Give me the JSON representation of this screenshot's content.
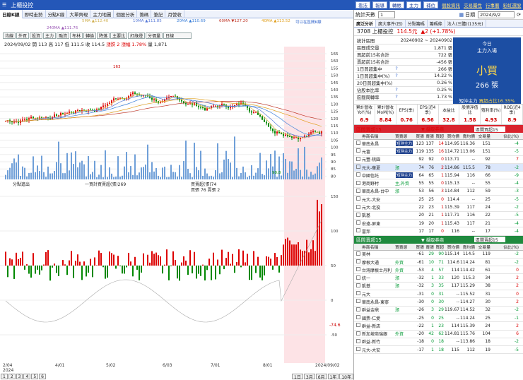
{
  "window": {
    "title": "上櫃投控",
    "buttons": [
      "看法",
      "報導",
      "轉帳",
      "主力",
      "補位"
    ],
    "links": [
      "個股資訊",
      "交易屬性",
      "行事曆",
      "彩虹選股"
    ]
  },
  "tabs": [
    "日線K線",
    "即時走勢",
    "分點K線",
    "大單齊現",
    "主力地圖",
    "個股分析",
    "籌碼",
    "筆記",
    "月營收"
  ],
  "legend": {
    "ma5": "5MA ▲112.40",
    "ma10": "10MA ▲111.85",
    "ma20": "20MA ▲110.69",
    "ma60": "60MA ▼127.20",
    "ma40": "40MA ▲113.52",
    "ma240": "240MA ▲111.76",
    "checkbox": "可以在區間K線"
  },
  "toolbar": [
    "均線",
    "外買",
    "投資",
    "主力",
    "融資",
    "布林",
    "轉換",
    "降落",
    "主要比",
    "紅綠燈",
    "分價量",
    "日線"
  ],
  "ohlc": {
    "date": "2024/09/02",
    "open": "開 113",
    "high": "高 117",
    "low": "低 111.5",
    "close": "收 114.5",
    "change": "漲跌 2",
    "pct": "漲幅 1.78%",
    "vol": "量 1,871"
  },
  "price_labels": {
    "high": "163",
    "low": "90.8"
  },
  "y_ticks": [
    "165",
    "160",
    "155",
    "150",
    "145",
    "140",
    "135",
    "130",
    "125",
    "120",
    "115",
    "110",
    "105",
    "100",
    "95",
    "90",
    "85",
    "80"
  ],
  "sub": {
    "label": "分點進出",
    "legend1": "一買計買賣超(張)269",
    "legend2": "買賣超(張)74",
    "legend3": "買張 76 賣張 2",
    "ticks": [
      "150",
      "100",
      "50",
      "0",
      "-50",
      "-100"
    ],
    "val": "-74.6"
  },
  "x_dates": [
    "2/04\n2024",
    "4/01",
    "5/02",
    "6/03",
    "7/01",
    "8/01",
    "2024/09/02"
  ],
  "bottom": {
    "pages": [
      "1",
      "2",
      "3",
      "4",
      "5",
      "6"
    ],
    "ranges": [
      "1日",
      "3月",
      "6月",
      "1年",
      "10年"
    ]
  },
  "right": {
    "count_label": "統計天數",
    "count_val": "1",
    "date_label": "日期",
    "date_val": "2024/9/2",
    "rtabs": [
      "廣泛分析",
      "廣大事件(日)",
      "分點籌碼",
      "籌碼條",
      "法人(三體)(135元)"
    ],
    "stock": "3708 上櫃投控",
    "price": "114.5元",
    "chg": "▲2 (+1.78%)",
    "stats": [
      {
        "k": "統計區間",
        "v": "20240902 ~ 20240902",
        "q": ""
      },
      {
        "k": "區間成交量",
        "v": "1,871 張",
        "q": ""
      },
      {
        "k": "買超前15名合計",
        "v": "722 張",
        "q": ""
      },
      {
        "k": "賣超前15名合計",
        "v": "-456 張",
        "q": ""
      },
      {
        "k": "1日買超集中",
        "v": "266 張",
        "q": "?"
      },
      {
        "k": "1日買超集中(%)",
        "v": "14.22 %",
        "q": "?"
      },
      {
        "k": "20日買超集中(%)",
        "v": "0.26 %",
        "q": ""
      },
      {
        "k": "佔股本比率",
        "v": "0.25 %",
        "q": "?"
      },
      {
        "k": "區間周轉率",
        "v": "1.73 %",
        "q": "?"
      }
    ],
    "big": {
      "l1": "今日",
      "l2": "主力入場",
      "l3": "小買",
      "l4": "266 張",
      "l5a": "短沖主力",
      "l5b": "買超占比16.35%"
    },
    "metrics": [
      {
        "h": "累計營收YoY(%)",
        "v": "6.9"
      },
      {
        "h": "累計營收MoM(%)",
        "v": "8.84"
      },
      {
        "h": "EPS(季)",
        "v": "0.76"
      },
      {
        "h": "EPS(近4季)",
        "v": "6.56"
      },
      {
        "h": "本益比",
        "v": "32.8"
      },
      {
        "h": "股價淨值比",
        "v": "1.58"
      },
      {
        "h": "殖利率(%)",
        "v": "4.93"
      },
      {
        "h": "ROE(近4季)",
        "v": "8.9"
      }
    ],
    "buy_hdr": "區間買超15",
    "buy_mid": "▼ 擷取券商",
    "dd": "區間買超15",
    "cols": [
      "",
      "券商名稱",
      "買賣原",
      "買張",
      "賣張",
      "買超",
      "買均價",
      "賣均價",
      "交易量",
      "佔比(%)"
    ],
    "buys": [
      [
        "華南永昌",
        "短沖主力",
        "123",
        "137",
        "14",
        "114.95",
        "116.36",
        "151",
        "-4"
      ],
      [
        "元富",
        "短沖主力",
        "119",
        "135",
        "16",
        "114.72",
        "113.06",
        "151",
        "-5"
      ],
      [
        "元豐-桃園",
        "",
        "92",
        "92",
        "0",
        "113.71",
        "--",
        "92",
        "7"
      ],
      [
        "元大-華夏",
        "漲",
        "74",
        "76",
        "2",
        "114.86",
        "115.5",
        "78",
        "-2"
      ],
      [
        "中國信託",
        "短沖主力",
        "64",
        "65",
        "1",
        "115.94",
        "116",
        "66",
        "-9"
      ],
      [
        "港商野村",
        "主,外資",
        "55",
        "55",
        "0",
        "115.13",
        "--",
        "55",
        "-4"
      ],
      [
        "華南永昌-台中",
        "漲",
        "53",
        "56",
        "3",
        "114.84",
        "112",
        "59",
        "-3"
      ],
      [
        "元大-大安",
        "",
        "25",
        "25",
        "0",
        "114.4",
        "--",
        "25",
        "-5"
      ],
      [
        "元大-北投",
        "",
        "22",
        "23",
        "1",
        "115.39",
        "117",
        "24",
        "-2"
      ],
      [
        "凱基",
        "",
        "20",
        "21",
        "1",
        "117.71",
        "116",
        "22",
        "-5"
      ],
      [
        "宏遠-屏東",
        "",
        "19",
        "20",
        "1",
        "115.43",
        "117",
        "21",
        "-4"
      ],
      [
        "富邦",
        "",
        "17",
        "17",
        "0",
        "116",
        "--",
        "17",
        "-4"
      ]
    ],
    "sell_hdr": "區間賣超15",
    "sell_mid": "▼ 擷取券商",
    "dd2": "區間賣超15",
    "sells": [
      [
        "美林",
        "",
        -61,
        "29",
        "90",
        "115.14",
        "114.5",
        "119",
        "-2"
      ],
      [
        "摩根大通",
        "外資",
        "-61",
        "10",
        "71",
        "114.6",
        "114.24",
        "81",
        "-2"
      ],
      [
        "台灣摩根士丹利",
        "外資",
        "-53",
        "4",
        "57",
        "114",
        "114.42",
        "61",
        "0"
      ],
      [
        "統一",
        "漲",
        "-32",
        "1",
        "33",
        "120",
        "115.3",
        "34",
        "2"
      ],
      [
        "凱基",
        "漲",
        "-32",
        "3",
        "35",
        "117",
        "115.29",
        "38",
        "2"
      ],
      [
        "元大",
        "",
        "-31",
        "0",
        "31",
        "--",
        "115.52",
        "31",
        "0"
      ],
      [
        "華南永昌-東寧",
        "",
        "-30",
        "0",
        "30",
        "--",
        "114.27",
        "30",
        "2"
      ],
      [
        "群益金鼎",
        "漲",
        "-26",
        "3",
        "29",
        "119.67",
        "114.52",
        "32",
        "-2"
      ],
      [
        "國票-仁愛",
        "",
        "-25",
        "0",
        "25",
        "--",
        "114.24",
        "25",
        "-1"
      ],
      [
        "群益-新店",
        "",
        "-22",
        "1",
        "23",
        "114",
        "115.39",
        "24",
        "2"
      ],
      [
        "新加坡商瑞銀",
        "外資",
        "-20",
        "42",
        "62",
        "114.81",
        "115.76",
        "104",
        "6"
      ],
      [
        "群益-新竹",
        "",
        "-18",
        "0",
        "18",
        "--",
        "113.86",
        "18",
        "-2"
      ],
      [
        "元大-大安",
        "",
        "-17",
        "1",
        "18",
        "115",
        "112",
        "19",
        "-5"
      ]
    ]
  }
}
